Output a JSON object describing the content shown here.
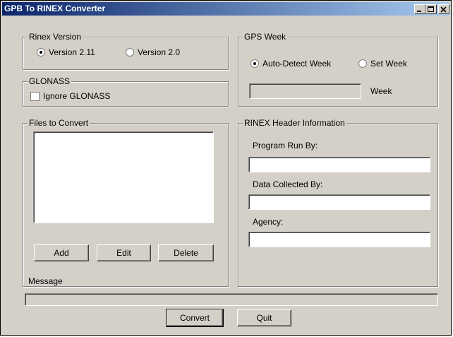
{
  "window": {
    "title": "GPB To RINEX Converter"
  },
  "rinex_version": {
    "legend": "Rinex Version",
    "options": [
      {
        "label": "Version 2.11",
        "selected": true
      },
      {
        "label": "Version 2.0",
        "selected": false
      }
    ]
  },
  "glonass": {
    "legend": "GLONASS",
    "ignore_label": "Ignore GLONASS",
    "checked": false
  },
  "files": {
    "legend": "Files to Convert",
    "items": [],
    "add_label": "Add",
    "edit_label": "Edit",
    "delete_label": "Delete"
  },
  "gps_week": {
    "legend": "GPS Week",
    "options": [
      {
        "label": "Auto-Detect Week",
        "selected": true
      },
      {
        "label": "Set Week",
        "selected": false
      }
    ],
    "week_value": "",
    "week_label": "Week"
  },
  "header_info": {
    "legend": "RINEX Header Information",
    "program_run_by_label": "Program Run By:",
    "program_run_by_value": "",
    "data_collected_by_label": "Data Collected By:",
    "data_collected_by_value": "",
    "agency_label": "Agency:",
    "agency_value": ""
  },
  "message": {
    "label": "Message",
    "text": ""
  },
  "actions": {
    "convert_label": "Convert",
    "quit_label": "Quit"
  }
}
